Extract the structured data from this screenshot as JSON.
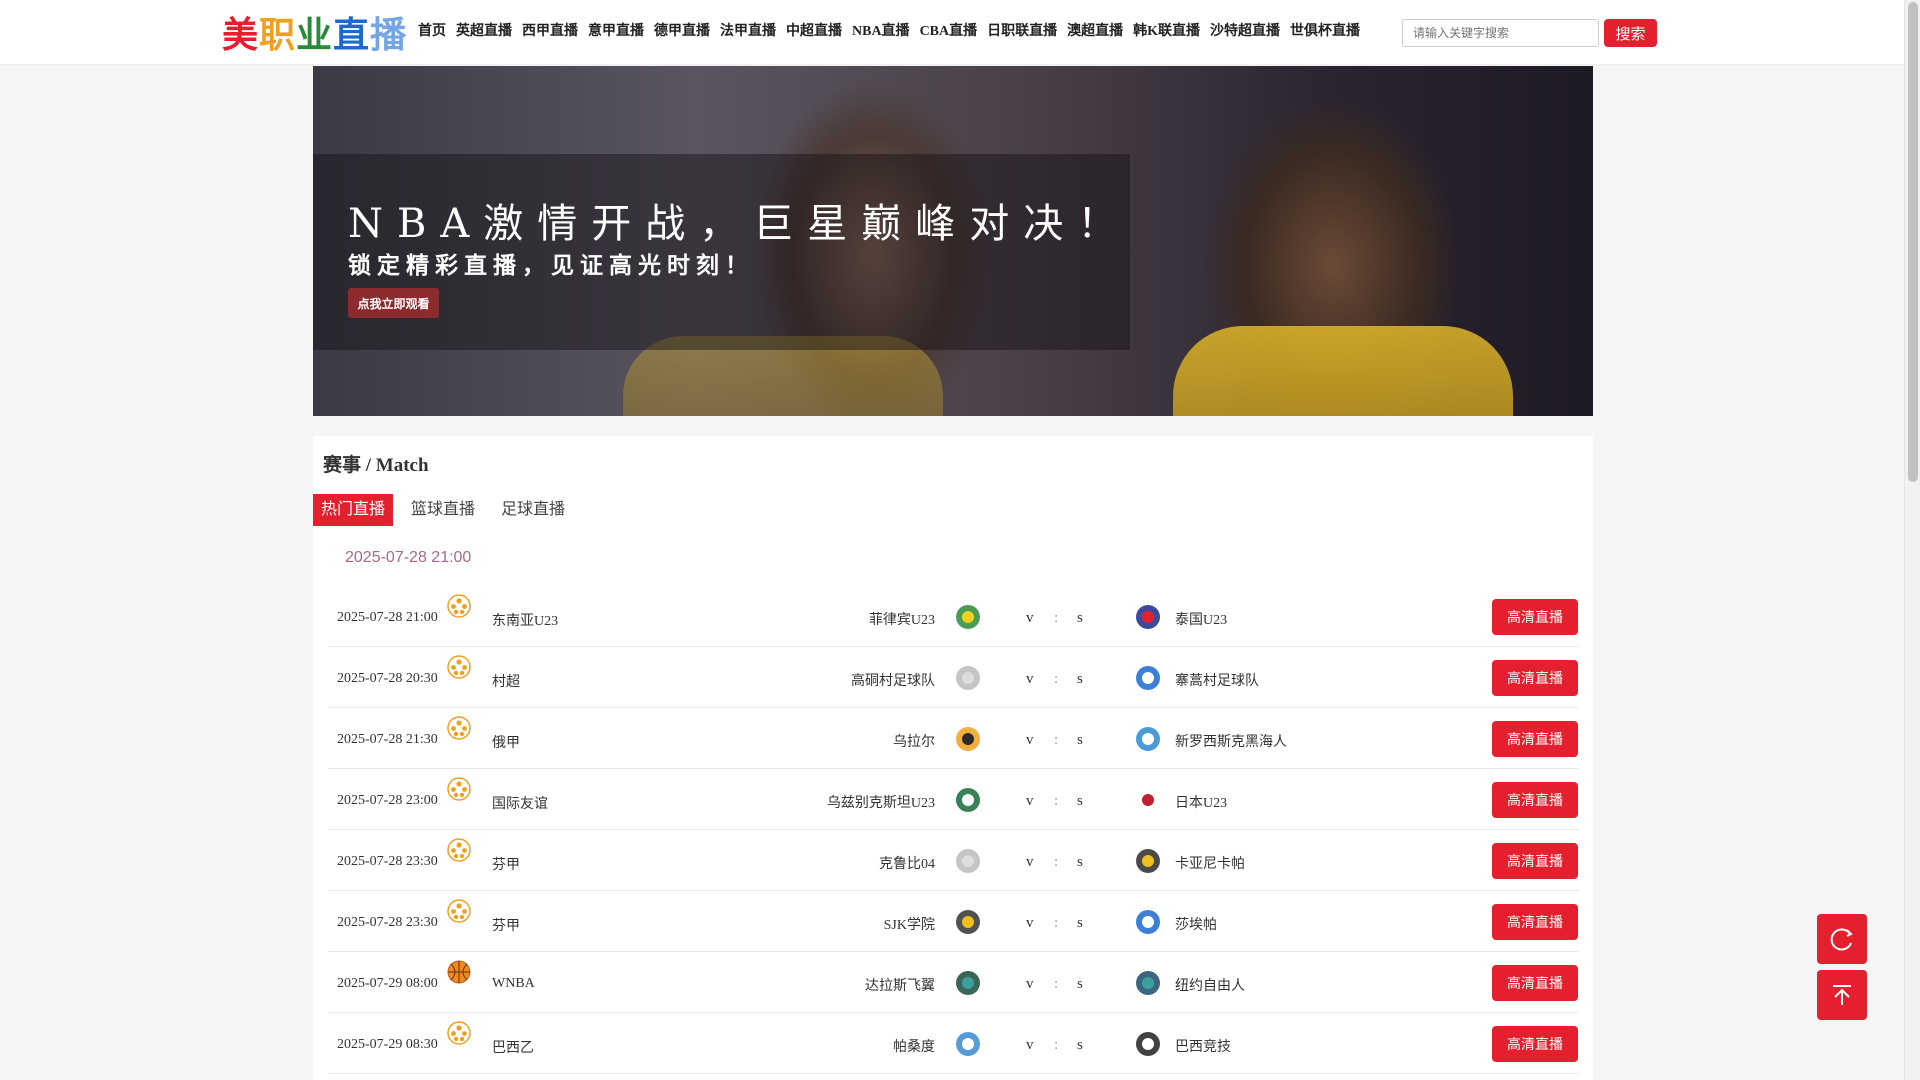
{
  "brand": {
    "name": "美职业直播",
    "colors": {
      "primary": "#e5202e",
      "logo1": "#e5202e",
      "logo2": "#f0a020",
      "logo3": "#2a8a3a",
      "logo4": "#1a6ad0"
    }
  },
  "nav": [
    "首页",
    "英超直播",
    "西甲直播",
    "意甲直播",
    "德甲直播",
    "法甲直播",
    "中超直播",
    "NBA直播",
    "CBA直播",
    "日职联直播",
    "澳超直播",
    "韩K联直播",
    "沙特超直播",
    "世俱杯直播"
  ],
  "search": {
    "placeholder": "请输入关键字搜索",
    "button": "搜索"
  },
  "banner": {
    "headline": "NBA激情开战，巨星巅峰对决！",
    "sub": "锁定精彩直播，见证高光时刻！",
    "button": "点我立即观看"
  },
  "panel": {
    "title": "赛事 / Match",
    "tabs": [
      "热门直播",
      "篮球直播",
      "足球直播"
    ],
    "active_tab": "热门直播",
    "date_header": "2025-07-28 21:00"
  },
  "matches": [
    {
      "time": "2025-07-28 21:00",
      "sport": "football",
      "league": "东南亚U23",
      "home": "菲律宾U23",
      "away": "泰国U23",
      "v": "v",
      "s": "s",
      "button": "高清直播"
    },
    {
      "time": "2025-07-28 20:30",
      "sport": "football",
      "league": "村超",
      "home": "高硐村足球队",
      "away": "寨蒿村足球队",
      "v": "v",
      "s": "s",
      "button": "高清直播"
    },
    {
      "time": "2025-07-28 21:30",
      "sport": "football",
      "league": "俄甲",
      "home": "乌拉尔",
      "away": "新罗西斯克黑海人",
      "v": "v",
      "s": "s",
      "button": "高清直播"
    },
    {
      "time": "2025-07-28 23:00",
      "sport": "football",
      "league": "国际友谊",
      "home": "乌兹别克斯坦U23",
      "away": "日本U23",
      "v": "v",
      "s": "s",
      "button": "高清直播"
    },
    {
      "time": "2025-07-28 23:30",
      "sport": "football",
      "league": "芬甲",
      "home": "克鲁比04",
      "away": "卡亚尼卡帕",
      "v": "v",
      "s": "s",
      "button": "高清直播"
    },
    {
      "time": "2025-07-28 23:30",
      "sport": "football",
      "league": "芬甲",
      "home": "SJK学院",
      "away": "莎埃帕",
      "v": "v",
      "s": "s",
      "button": "高清直播"
    },
    {
      "time": "2025-07-29 08:00",
      "sport": "basketball",
      "league": "WNBA",
      "home": "达拉斯飞翼",
      "away": "纽约自由人",
      "v": "v",
      "s": "s",
      "button": "高清直播"
    },
    {
      "time": "2025-07-29 08:30",
      "sport": "football",
      "league": "巴西乙",
      "home": "帕桑度",
      "away": "巴西竞技",
      "v": "v",
      "s": "s",
      "button": "高清直播"
    }
  ],
  "colon": ":",
  "icons": {
    "refresh": "refresh-icon",
    "top": "back-to-top-icon",
    "football": "football-icon",
    "basketball": "basketball-icon"
  }
}
